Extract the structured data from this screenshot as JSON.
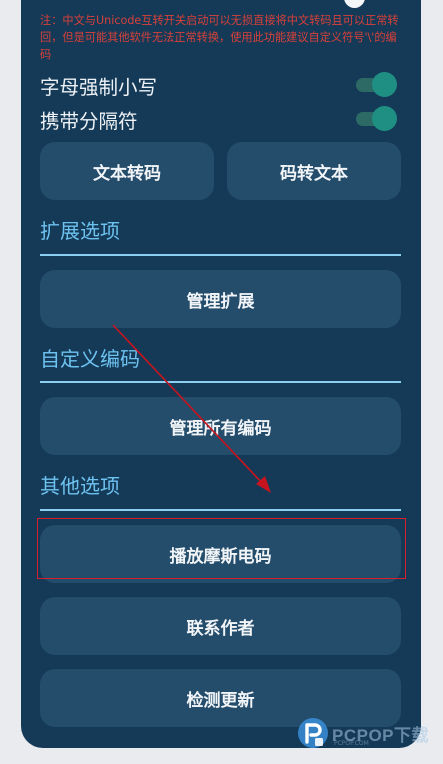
{
  "partial_top_row": {
    "label": ""
  },
  "note": {
    "text": "注：中文与Unicode互转开关启动可以无损直接将中文转码且可以正常转回，但是可能其他软件无法正常转换，使用此功能建议自定义符号'\\'的编码"
  },
  "toggles": [
    {
      "label": "字母强制小写",
      "state": "on"
    },
    {
      "label": "携带分隔符",
      "state": "on"
    }
  ],
  "convert_buttons": {
    "text_to_code": "文本转码",
    "code_to_text": "码转文本"
  },
  "sections": {
    "extensions": {
      "title": "扩展选项",
      "button": "管理扩展"
    },
    "custom_encoding": {
      "title": "自定义编码",
      "button": "管理所有编码"
    },
    "other": {
      "title": "其他选项",
      "buttons": {
        "play_morse": "播放摩斯电码",
        "contact_author": "联系作者",
        "check_update": "检测更新"
      }
    }
  },
  "annotation": {
    "arrow_color": "#c8141e",
    "highlight_color": "#d81f2a",
    "highlighted_item": "播放摩斯电码"
  },
  "watermark": {
    "text": "PCPOP下载",
    "subtext": "PCPOP.COM",
    "icon": "p-logo-icon"
  },
  "colors": {
    "panel_bg": "#143a57",
    "button_bg": "#244c6b",
    "section_title": "#6ec2f0",
    "toggle_on": "#1f8f83",
    "note_text": "#d8403a"
  }
}
